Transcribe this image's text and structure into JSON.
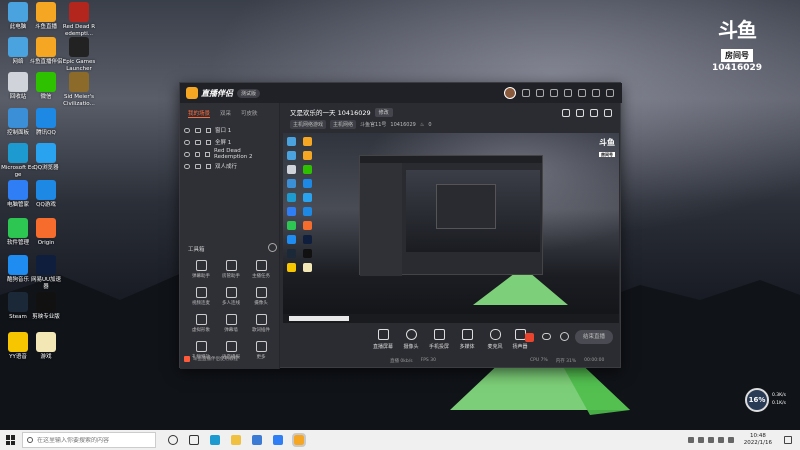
{
  "desktop": {
    "icons": [
      {
        "label": "此电脑",
        "color": "#4aa3df"
      },
      {
        "label": "斗鱼直播",
        "color": "#f5a623"
      },
      {
        "label": "Red Dead Redempti...",
        "color": "#b3261e"
      },
      {
        "label": "网络",
        "color": "#4aa3df"
      },
      {
        "label": "斗鱼直播伴侣",
        "color": "#f5a623"
      },
      {
        "label": "Epic Games Launcher",
        "color": "#222222"
      },
      {
        "label": "回收站",
        "color": "#d0d4da"
      },
      {
        "label": "微信",
        "color": "#2dc100"
      },
      {
        "label": "Sid Meier's Civilizatio...",
        "color": "#8c6a2a"
      },
      {
        "label": "控制面板",
        "color": "#3b8fd6"
      },
      {
        "label": "腾讯QQ",
        "color": "#1e88e5"
      },
      {
        "label": "Microsoft Edge",
        "color": "#1d9bd1"
      },
      {
        "label": "QQ浏览器",
        "color": "#29a3f0"
      },
      {
        "label": "电脑管家",
        "color": "#2f7ef5"
      },
      {
        "label": "QQ游戏",
        "color": "#1e88e5"
      },
      {
        "label": "软件管理",
        "color": "#2dc653"
      },
      {
        "label": "Origin",
        "color": "#f56c2d"
      },
      {
        "label": "酷狗音乐",
        "color": "#1e8cf0"
      },
      {
        "label": "网易UU加速器",
        "color": "#0f1e3c"
      },
      {
        "label": "Steam",
        "color": "#1b2838"
      },
      {
        "label": "剪映专业版",
        "color": "#111111"
      },
      {
        "label": "YY语音",
        "color": "#f7c600"
      },
      {
        "label": "游戏",
        "color": "#f3e7b5"
      }
    ]
  },
  "room_badge": {
    "logo": "斗鱼",
    "tag": "房间号",
    "room_number": "10416029"
  },
  "app": {
    "brand_name": "直播伴侣",
    "brand_badge": "测试版",
    "tabs": [
      "我的场景",
      "双采",
      "可皮肤"
    ],
    "scenes": [
      {
        "label": "窗口 1"
      },
      {
        "label": "全屏 1"
      },
      {
        "label": "Red Dead Redemption 2"
      },
      {
        "label": "双人成行"
      }
    ],
    "toolbox_title": "工具箱",
    "tools": [
      "弹幕助手",
      "房管助手",
      "主播任务",
      "视频连麦",
      "多人连线",
      "摄像头",
      "虚拟形象",
      "弹幕墙",
      "歌词插件",
      "礼物特效",
      "语音播报",
      "更多"
    ],
    "footer_text": "斗鱼直播伴侣使用教程",
    "stream_title": "又是欢乐的一天 10416029",
    "edit_label": "修改",
    "category_chips": [
      "主机网络游戏",
      "主机网络"
    ],
    "meta_room": "斗鱼官11号",
    "meta_id": "10416029",
    "meta_count": "0",
    "controls": [
      "直播屏幕",
      "摄像头",
      "手机投屏",
      "多媒体",
      "麦克风",
      "扬声器"
    ],
    "live_button": "结束直播",
    "status_left": [
      "直播 0kb/s",
      "FPS 30"
    ],
    "status_right": [
      "CPU 7%",
      "内存 31%",
      "00:00:00"
    ]
  },
  "perf_widget": {
    "percent": "16%",
    "up": "0.3K/s",
    "down": "0.1K/s"
  },
  "taskbar": {
    "search_placeholder": "在这里输入你要搜索的内容",
    "time": "10:48",
    "date": "2022/1/16"
  }
}
